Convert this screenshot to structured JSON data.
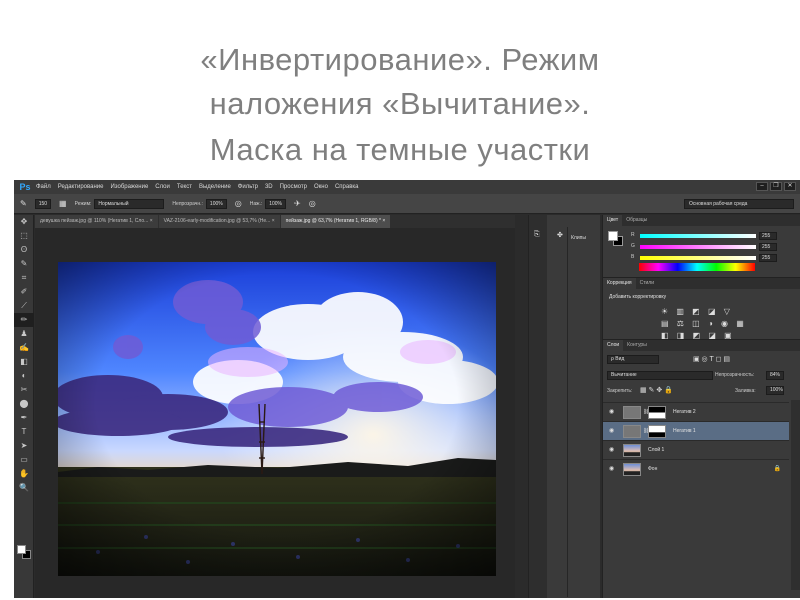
{
  "slide": {
    "title_line1": "«Инвертирование». Режим",
    "title_line2": "наложения «Вычитание».",
    "subtitle": "Маска на темные участки"
  },
  "app": {
    "logo": "Ps",
    "menu": [
      "Файл",
      "Редактирование",
      "Изображение",
      "Слои",
      "Текст",
      "Выделение",
      "Фильтр",
      "3D",
      "Просмотр",
      "Окно",
      "Справка"
    ],
    "window_controls": [
      "–",
      "❐",
      "✕"
    ]
  },
  "options_bar": {
    "brush_size": "150",
    "mode_label": "Режим:",
    "mode_value": "Нормальный",
    "opacity_label": "Непрозрачн.:",
    "opacity_value": "100%",
    "flow_label": "Наж.:",
    "flow_value": "100%",
    "workspace": "Основная рабочая среда"
  },
  "tabs": [
    {
      "label": "девушка пейзаж.jpg @ 110% (Негатив 1, Сло... ×",
      "active": false
    },
    {
      "label": "VAZ-2106-early-modification.jpg @ 53,7% (Не... ×",
      "active": false
    },
    {
      "label": "пейзаж.jpg @ 63,7% (Негатив 1, RGB/8) * ×",
      "active": true
    }
  ],
  "tools": [
    "✥",
    "⬚",
    "ʘ",
    "✎",
    "⌗",
    "✐",
    "⟋",
    "✏",
    "♟",
    "✍",
    "◧",
    "◐",
    "✂",
    "⬤",
    "✒",
    "T",
    "➤",
    "▭",
    "✋",
    "🔍"
  ],
  "dock": {
    "history_label": "Клипы"
  },
  "color_panel": {
    "tabs": [
      "Цвет",
      "Образцы"
    ],
    "channels": [
      {
        "label": "R",
        "value": "255",
        "gradient": "linear-gradient(to right,#00ffff,#ffffff)"
      },
      {
        "label": "G",
        "value": "255",
        "gradient": "linear-gradient(to right,#ff00ff,#ffffff)"
      },
      {
        "label": "B",
        "value": "255",
        "gradient": "linear-gradient(to right,#ffff00,#ffffff)"
      }
    ]
  },
  "adjustments_panel": {
    "tabs": [
      "Коррекция",
      "Стили"
    ],
    "title": "Добавить корректировку",
    "icons_row1": "☀ ▥ ◩ ◪ ▽",
    "icons_row2": "▤ ⚖ ◫ ◑ ◉ ▦",
    "icons_row3": "◧ ◨ ◩ ◪ ▣"
  },
  "layers_panel": {
    "tabs": [
      "Слои",
      "Контуры"
    ],
    "filter_label": "ρ Вид",
    "blend_mode": "Вычитание",
    "opacity_label": "Непрозрачность:",
    "opacity_value": "84%",
    "lock_label": "Закрепить:",
    "fill_label": "Заливка:",
    "fill_value": "100%",
    "layers": [
      {
        "name": "Негатив 2",
        "selected": false,
        "kind": "adjust-mask"
      },
      {
        "name": "Негатив 1",
        "selected": true,
        "kind": "adjust-mask"
      },
      {
        "name": "Слой 1",
        "selected": false,
        "kind": "photo"
      },
      {
        "name": "Фон",
        "selected": false,
        "kind": "photo-locked"
      }
    ]
  }
}
